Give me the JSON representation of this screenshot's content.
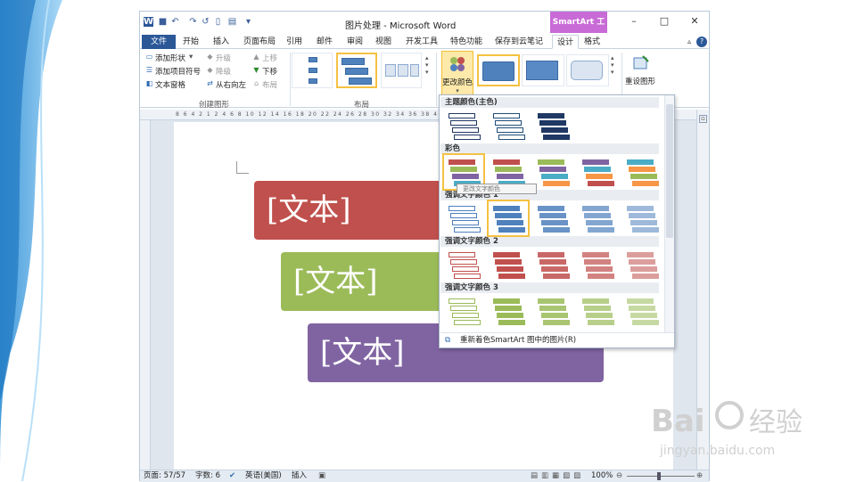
{
  "app": {
    "title": "图片处理 - Microsoft Word",
    "context_tab_group": "SmartArt 工具",
    "qat_icons": [
      "word-icon",
      "save-icon",
      "undo-icon",
      "redo-icon",
      "repeat-icon",
      "new-icon",
      "print-icon",
      "customize-icon"
    ],
    "window_controls": [
      "–",
      "□",
      "✕"
    ]
  },
  "tabs": [
    "文件",
    "开始",
    "插入",
    "页面布局",
    "引用",
    "邮件",
    "审阅",
    "视图",
    "开发工具",
    "特色功能",
    "保存到云笔记",
    "设计",
    "格式"
  ],
  "ribbon": {
    "create_group": {
      "label": "创建图形",
      "add_shape": "添加形状",
      "add_bullet": "添加项目符号",
      "text_pane": "文本窗格",
      "promote": "升级",
      "demote": "降级",
      "rtl": "从右向左",
      "move_up": "上移",
      "move_down": "下移",
      "layout": "布局"
    },
    "layout_group": {
      "label": "布局"
    },
    "change_color": "更改颜色",
    "reset": "重设图形"
  },
  "dropdown": {
    "sections": [
      "主题颜色(主色)",
      "彩色",
      "强调文字颜色 1",
      "强调文字颜色 2",
      "强调文字颜色 3"
    ],
    "tooltip": "更改文字颜色",
    "footer": "重新着色SmartArt 图中的图片(R)",
    "colors": {
      "theme": [
        "#1f3864",
        "#1f4e79",
        "#1f3864"
      ],
      "colorful": [
        [
          "#c0504d",
          "#9bbb59",
          "#8064a2",
          "#4bacc6",
          "#f79646"
        ],
        [
          "#c0504d",
          "#9bbb59",
          "#8064a2",
          "#4bacc6"
        ],
        [
          "#9bbb59",
          "#8064a2",
          "#4bacc6",
          "#f79646"
        ],
        [
          "#8064a2",
          "#4bacc6",
          "#f79646",
          "#c0504d"
        ],
        [
          "#4bacc6",
          "#f79646",
          "#9bbb59",
          "#f79646"
        ]
      ],
      "accent1": "#4f81bd",
      "accent2": "#c0504d",
      "accent3": "#9bbb59"
    }
  },
  "document": {
    "boxes": [
      {
        "text": "[文本]",
        "color": "#c0504d"
      },
      {
        "text": "[文本]",
        "color": "#9bbb59"
      },
      {
        "text": "[文本]",
        "color": "#8064a2"
      }
    ]
  },
  "status": {
    "page": "页面: 57/57",
    "words": "字数: 6",
    "lang": "英语(美国)",
    "mode": "插入",
    "zoom": "100%"
  },
  "ruler_text": "8 6 4 2 1 2 4 6 8 10 12 14 16 18 20 22 24 26 28 30 32 34 36 38 40 42 44 46 48"
}
